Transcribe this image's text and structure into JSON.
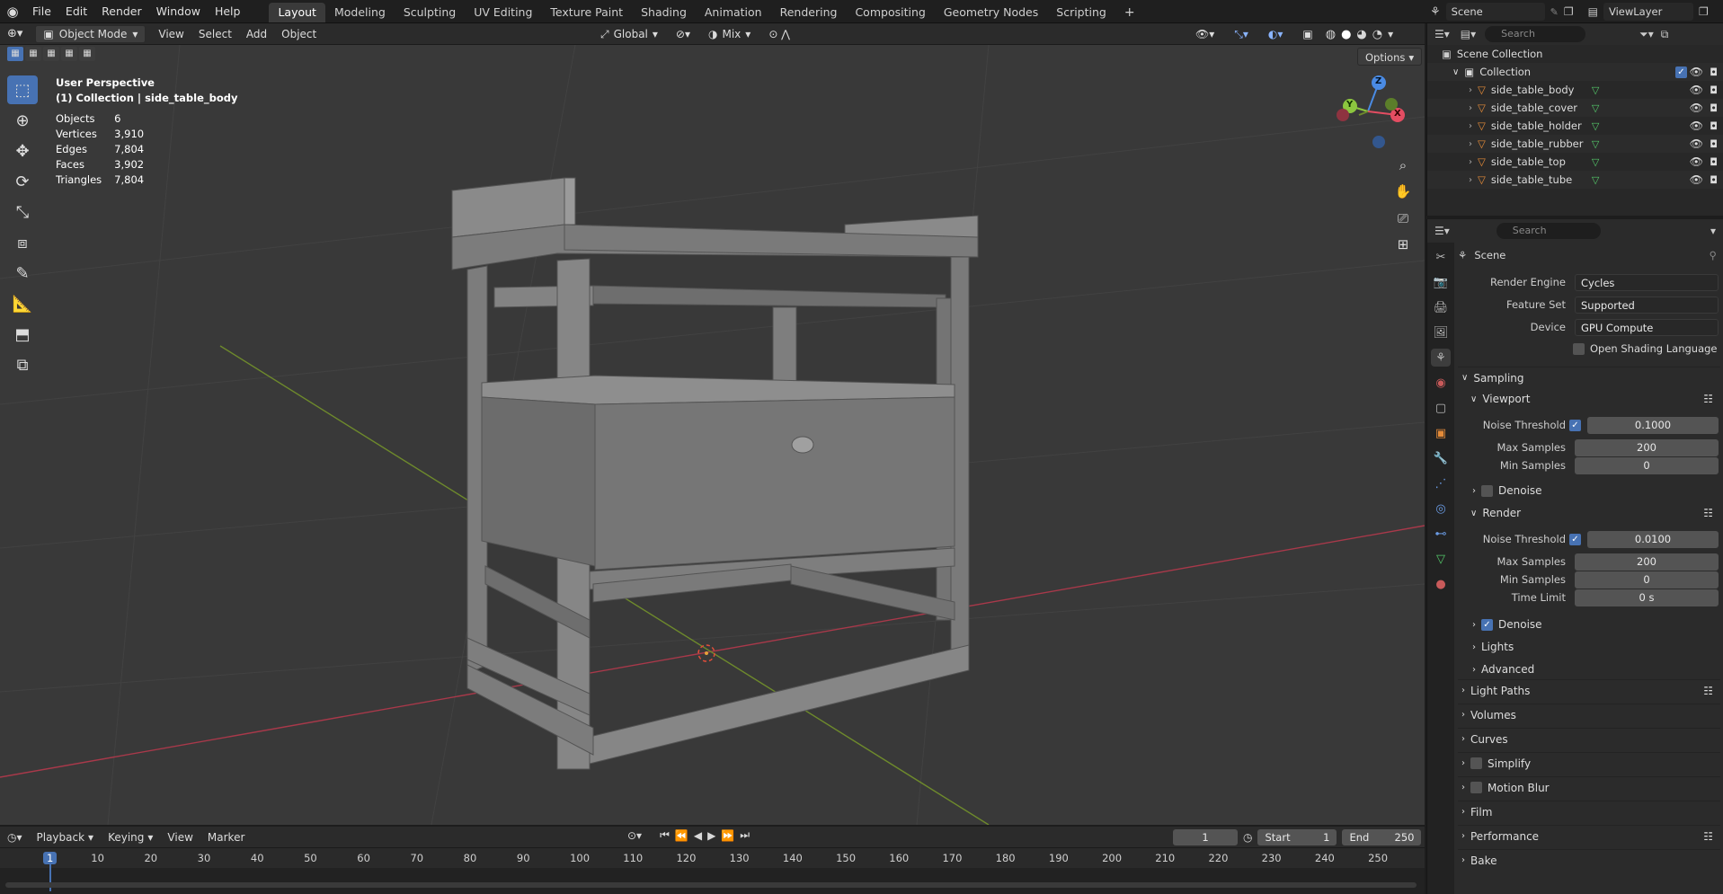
{
  "app": {
    "menu": [
      "File",
      "Edit",
      "Render",
      "Window",
      "Help"
    ],
    "workspaces": [
      "Layout",
      "Modeling",
      "Sculpting",
      "UV Editing",
      "Texture Paint",
      "Shading",
      "Animation",
      "Rendering",
      "Compositing",
      "Geometry Nodes",
      "Scripting"
    ],
    "active_workspace": "Layout",
    "scene_name": "Scene",
    "view_layer": "ViewLayer"
  },
  "viewport_header": {
    "mode": "Object Mode",
    "menus": [
      "View",
      "Select",
      "Add",
      "Object"
    ],
    "transform_orientation": "Global",
    "snap_target": "Mix",
    "options_label": "Options"
  },
  "overlay": {
    "perspective": "User Perspective",
    "collection_line": "(1) Collection | side_table_body",
    "stats": [
      {
        "label": "Objects",
        "value": "6"
      },
      {
        "label": "Vertices",
        "value": "3,910"
      },
      {
        "label": "Edges",
        "value": "7,804"
      },
      {
        "label": "Faces",
        "value": "3,902"
      },
      {
        "label": "Triangles",
        "value": "7,804"
      }
    ],
    "gizmo_axes": [
      "X",
      "Y",
      "Z"
    ]
  },
  "outliner": {
    "search_placeholder": "Search",
    "scene_collection": "Scene Collection",
    "collection": "Collection",
    "objects": [
      "side_table_body",
      "side_table_cover",
      "side_table_holder",
      "side_table_rubber",
      "side_table_top",
      "side_table_tube"
    ]
  },
  "properties": {
    "search_placeholder": "Search",
    "context": "Scene",
    "render_engine_label": "Render Engine",
    "render_engine": "Cycles",
    "feature_set_label": "Feature Set",
    "feature_set": "Supported",
    "device_label": "Device",
    "device": "GPU Compute",
    "osl_label": "Open Shading Language",
    "sampling": "Sampling",
    "viewport": {
      "title": "Viewport",
      "noise_threshold_label": "Noise Threshold",
      "noise_threshold": "0.1000",
      "max_samples_label": "Max Samples",
      "max_samples": "200",
      "min_samples_label": "Min Samples",
      "min_samples": "0",
      "denoise_label": "Denoise"
    },
    "render": {
      "title": "Render",
      "noise_threshold_label": "Noise Threshold",
      "noise_threshold": "0.0100",
      "max_samples_label": "Max Samples",
      "max_samples": "200",
      "min_samples_label": "Min Samples",
      "min_samples": "0",
      "time_limit_label": "Time Limit",
      "time_limit": "0 s",
      "denoise_label": "Denoise"
    },
    "sampling_subpanels": [
      "Lights",
      "Advanced"
    ],
    "panels": [
      "Light Paths",
      "Volumes",
      "Curves",
      "Simplify",
      "Motion Blur",
      "Film",
      "Performance",
      "Bake"
    ]
  },
  "timeline": {
    "menus": [
      "Playback",
      "Keying",
      "View",
      "Marker"
    ],
    "current_frame": "1",
    "start_label": "Start",
    "start": "1",
    "end_label": "End",
    "end": "250",
    "ruler_ticks": [
      "1",
      "10",
      "20",
      "30",
      "40",
      "50",
      "60",
      "70",
      "80",
      "90",
      "100",
      "110",
      "120",
      "130",
      "140",
      "150",
      "160",
      "170",
      "180",
      "190",
      "200",
      "210",
      "220",
      "230",
      "240",
      "250"
    ]
  },
  "colors": {
    "accent": "#4772b3",
    "object_icon": "#e48b39",
    "mesh_icon": "#54c86a",
    "axis_x": "#e44d62",
    "axis_y": "#8cc63f",
    "axis_z": "#4a8be4"
  }
}
